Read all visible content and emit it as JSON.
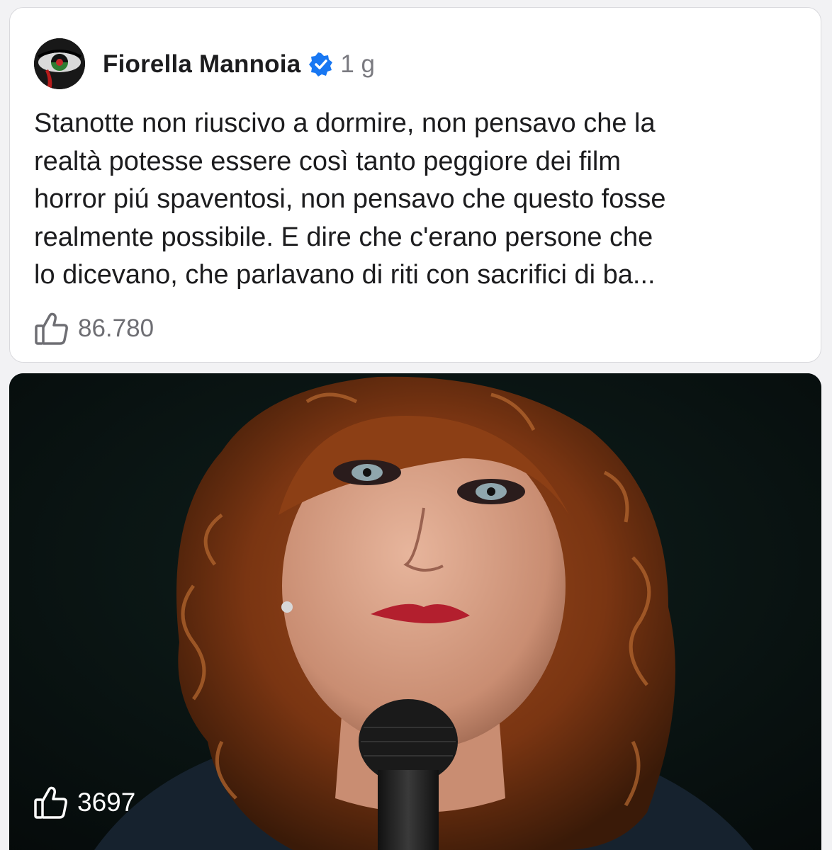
{
  "post": {
    "author": "Fiorella Mannoia",
    "time": "1 g",
    "text_lines": [
      "Stanotte non riuscivo a dormire, non pensavo che la",
      "realtà potesse essere così tanto peggiore dei film",
      "horror piú spaventosi, non pensavo che questo fosse",
      "realmente possibile. E dire che c'erano persone che",
      "lo dicevano, che parlavano di riti con sacrifici di ba..."
    ],
    "likes": "86.780",
    "verified_color": "#1877f2"
  },
  "media": {
    "likes": "3697"
  },
  "icons": {
    "avatar": "avatar-eye-image",
    "verified": "verified-badge-icon",
    "like": "thumbs-up-icon"
  }
}
